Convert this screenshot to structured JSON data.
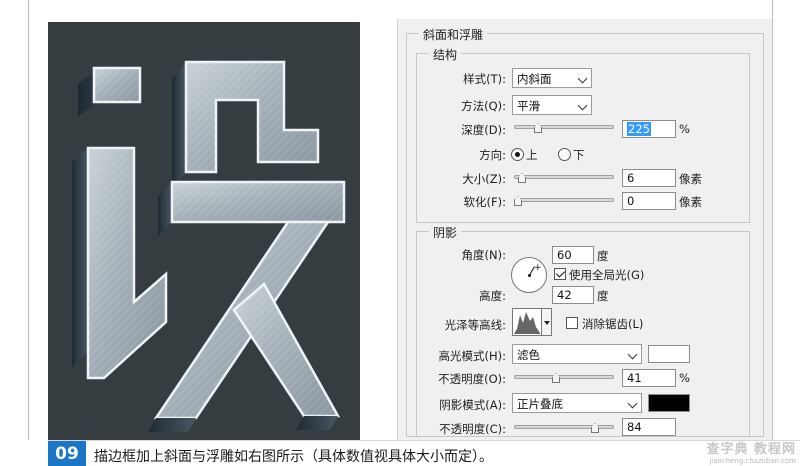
{
  "bevel_emboss": {
    "title": "斜面和浮雕",
    "structure": {
      "title": "结构",
      "style": {
        "label": "样式(T):",
        "value": "内斜面"
      },
      "technique": {
        "label": "方法(Q):",
        "value": "平滑"
      },
      "depth": {
        "label": "深度(D):",
        "value": "225",
        "unit": "%",
        "slider_fraction": 0.22
      },
      "direction": {
        "label": "方向:",
        "up": "上",
        "down": "下",
        "selected": "up"
      },
      "size": {
        "label": "大小(Z):",
        "value": "6",
        "unit": "像素",
        "slider_fraction": 0.04
      },
      "soften": {
        "label": "软化(F):",
        "value": "0",
        "unit": "像素",
        "slider_fraction": 0.0
      }
    },
    "shading": {
      "title": "阴影",
      "angle": {
        "label": "角度(N):",
        "value": "60",
        "unit": "度"
      },
      "use_global_light": {
        "label": "使用全局光(G)",
        "checked": true
      },
      "altitude": {
        "label": "高度:",
        "value": "42",
        "unit": "度"
      },
      "gloss_contour": {
        "label": "光泽等高线:",
        "anti_aliased_label": "消除锯齿(L)",
        "anti_aliased": false
      },
      "highlight_mode": {
        "label": "高光模式(H):",
        "value": "滤色",
        "color": "#ffffff"
      },
      "highlight_opacity": {
        "label": "不透明度(O):",
        "value": "41",
        "unit": "%",
        "slider_fraction": 0.41
      },
      "shadow_mode": {
        "label": "阴影模式(A):",
        "value": "正片叠底",
        "color": "#000000"
      },
      "shadow_opacity": {
        "label": "不透明度(C):",
        "value": "84",
        "slider_fraction": 0.84
      }
    }
  },
  "caption": {
    "step": "09",
    "text": "描边框加上斜面与浮雕如右图所示（具体数值视具体大小而定）。"
  },
  "watermark": {
    "main": "查字典 教程网",
    "sub": "jiaocheng.chazidian.com"
  },
  "colors": {
    "badge": "#1c76c8",
    "art_background": "#363d40",
    "panel": "#f0f0f0"
  }
}
